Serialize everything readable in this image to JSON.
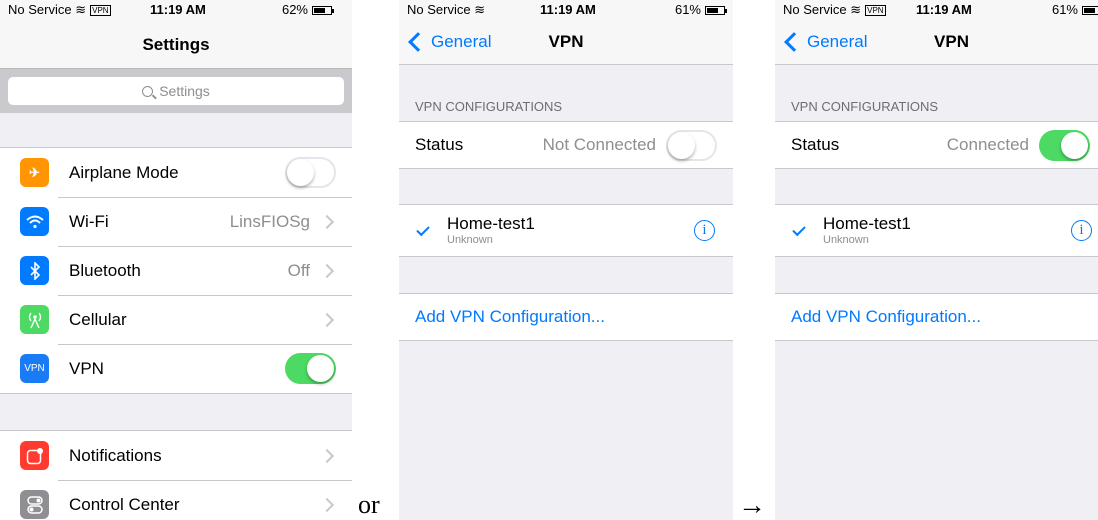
{
  "screen1": {
    "status": {
      "carrier": "No Service",
      "vpn": "VPN",
      "time": "11:19 AM",
      "battery": "62%"
    },
    "title": "Settings",
    "search_placeholder": "Settings",
    "group1": [
      {
        "label": "Airplane Mode",
        "icon": "airplane-icon",
        "icon_color": "#ff9500",
        "toggle": "off"
      },
      {
        "label": "Wi-Fi",
        "icon": "wifi-icon",
        "icon_color": "#007aff",
        "value": "LinsFIOSg"
      },
      {
        "label": "Bluetooth",
        "icon": "bluetooth-icon",
        "icon_color": "#007aff",
        "value": "Off"
      },
      {
        "label": "Cellular",
        "icon": "cellular-icon",
        "icon_color": "#4cd964",
        "value": ""
      },
      {
        "label": "VPN",
        "icon": "vpn-icon",
        "icon_text": "VPN",
        "icon_color": "#1a7cf5",
        "toggle": "on"
      }
    ],
    "group2": [
      {
        "label": "Notifications",
        "icon": "notifications-icon",
        "icon_color": "#ff3b30"
      },
      {
        "label": "Control Center",
        "icon": "control-center-icon",
        "icon_color": "#8e8e93"
      }
    ]
  },
  "separator_or": "or",
  "separator_arrow": "→",
  "screen2": {
    "status": {
      "carrier": "No Service",
      "time": "11:19 AM",
      "battery": "61%"
    },
    "back": "General",
    "title": "VPN",
    "section": "VPN CONFIGURATIONS",
    "status_label": "Status",
    "status_value": "Not Connected",
    "toggle": "off",
    "config_name": "Home-test1",
    "config_sub": "Unknown",
    "add": "Add VPN Configuration..."
  },
  "screen3": {
    "status": {
      "carrier": "No Service",
      "vpn": "VPN",
      "time": "11:19 AM",
      "battery": "61%"
    },
    "back": "General",
    "title": "VPN",
    "section": "VPN CONFIGURATIONS",
    "status_label": "Status",
    "status_value": "Connected",
    "toggle": "on",
    "config_name": "Home-test1",
    "config_sub": "Unknown",
    "add": "Add VPN Configuration..."
  },
  "colors": {
    "accent": "#007aff",
    "toggle_on": "#4cd964",
    "background": "#efeff4"
  }
}
